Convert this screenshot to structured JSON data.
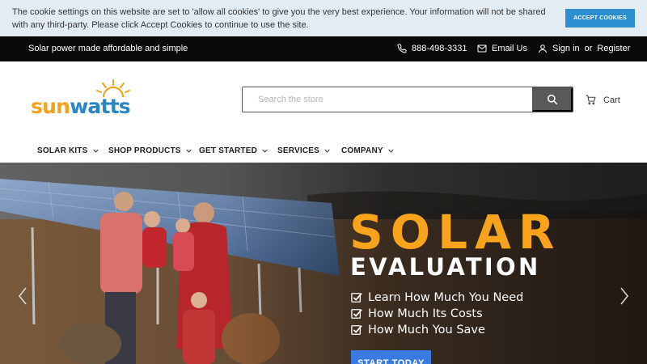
{
  "cookie": {
    "message": "The cookie settings on this website are set to 'allow all cookies' to give you the very best experience. Your information will not be shared with any third-party. Please click Accept Cookies to continue to use the site.",
    "accept_label": "ACCEPT COOKIES",
    "accent": "#2b8fcf"
  },
  "topbar": {
    "tagline": "Solar power made affordable and simple",
    "phone": "888-498-3331",
    "email_label": "Email Us",
    "sign_in": "Sign in",
    "or": "or",
    "register": "Register",
    "phone_icon": "phone-icon",
    "email_icon": "envelope-icon",
    "user_icon": "user-icon"
  },
  "header": {
    "logo": {
      "part1": "sun",
      "part2": "watts",
      "colors": [
        "#f4a11b",
        "#2b86c6"
      ]
    },
    "search": {
      "placeholder": "Search the store",
      "value": "",
      "icon": "search-icon"
    },
    "cart_label": "Cart",
    "cart_icon": "cart-icon"
  },
  "nav": {
    "items": [
      {
        "label": "SOLAR KITS"
      },
      {
        "label": "SHOP PRODUCTS"
      },
      {
        "label": "GET STARTED"
      },
      {
        "label": "SERVICES"
      },
      {
        "label": "COMPANY"
      }
    ],
    "dropdown_icon": "chevron-down-icon"
  },
  "hero": {
    "title": "SOLAR",
    "subtitle": "EVALUATION",
    "bullets": [
      "Learn How Much You Need",
      "How Much Its Costs",
      "How Much You Save"
    ],
    "cta_label": "START TODAY",
    "title_color": "#f7a41c",
    "cta_color": "#3b7ae0",
    "prev_icon": "chevron-left-icon",
    "next_icon": "chevron-right-icon"
  }
}
